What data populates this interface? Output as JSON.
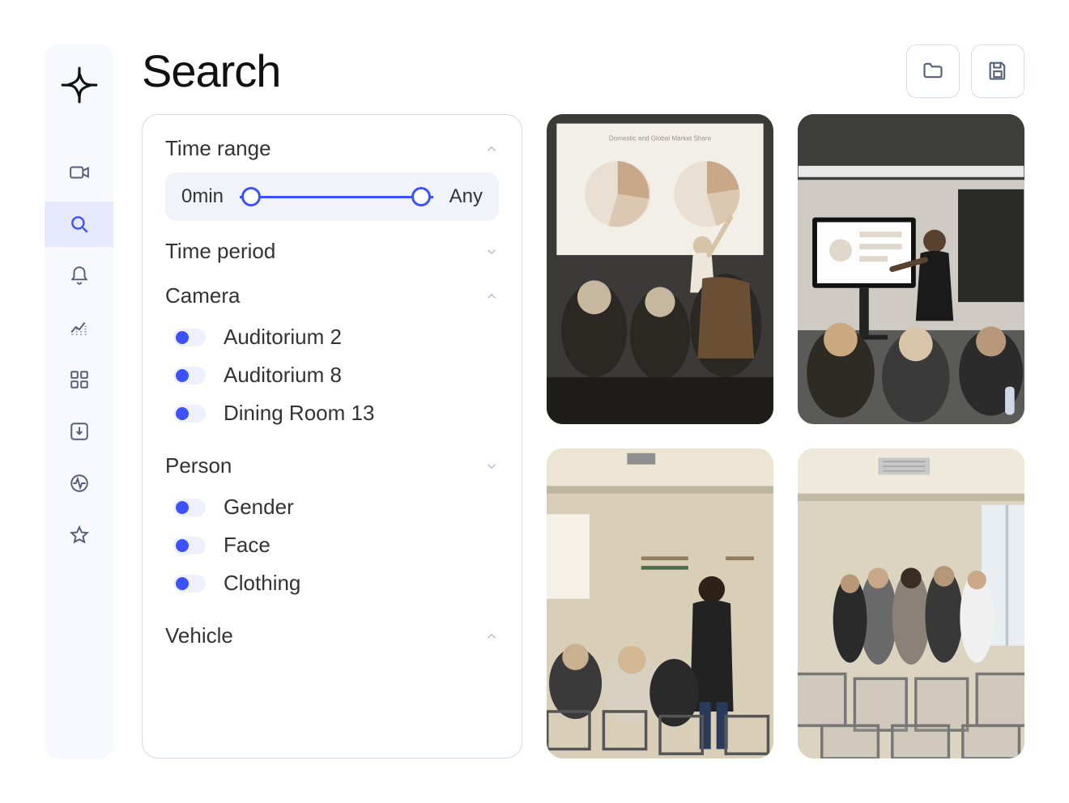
{
  "page": {
    "title": "Search"
  },
  "header": {
    "folder_btn": "folder",
    "save_btn": "save"
  },
  "sidebar": {
    "items": [
      "camera",
      "search",
      "bell",
      "analytics",
      "grid",
      "download",
      "activity",
      "star"
    ],
    "active_index": 1
  },
  "filters": {
    "time_range": {
      "title": "Time range",
      "min_label": "0min",
      "max_label": "Any"
    },
    "time_period": {
      "title": "Time period"
    },
    "camera": {
      "title": "Camera",
      "items": [
        {
          "label": "Auditorium 2",
          "on": true
        },
        {
          "label": "Auditorium 8",
          "on": true
        },
        {
          "label": "Dining Room 13",
          "on": true
        }
      ]
    },
    "person": {
      "title": "Person",
      "items": [
        {
          "label": "Gender",
          "on": true
        },
        {
          "label": "Face",
          "on": true
        },
        {
          "label": "Clothing",
          "on": true
        }
      ]
    },
    "vehicle": {
      "title": "Vehicle"
    }
  },
  "results": [
    {
      "name": "result-1"
    },
    {
      "name": "result-2"
    },
    {
      "name": "result-3"
    },
    {
      "name": "result-4"
    }
  ],
  "colors": {
    "accent": "#3c51ff",
    "sidebar_bg": "#f8f9ff",
    "active_bg": "#e7eaff",
    "border": "#d5d8ea"
  }
}
